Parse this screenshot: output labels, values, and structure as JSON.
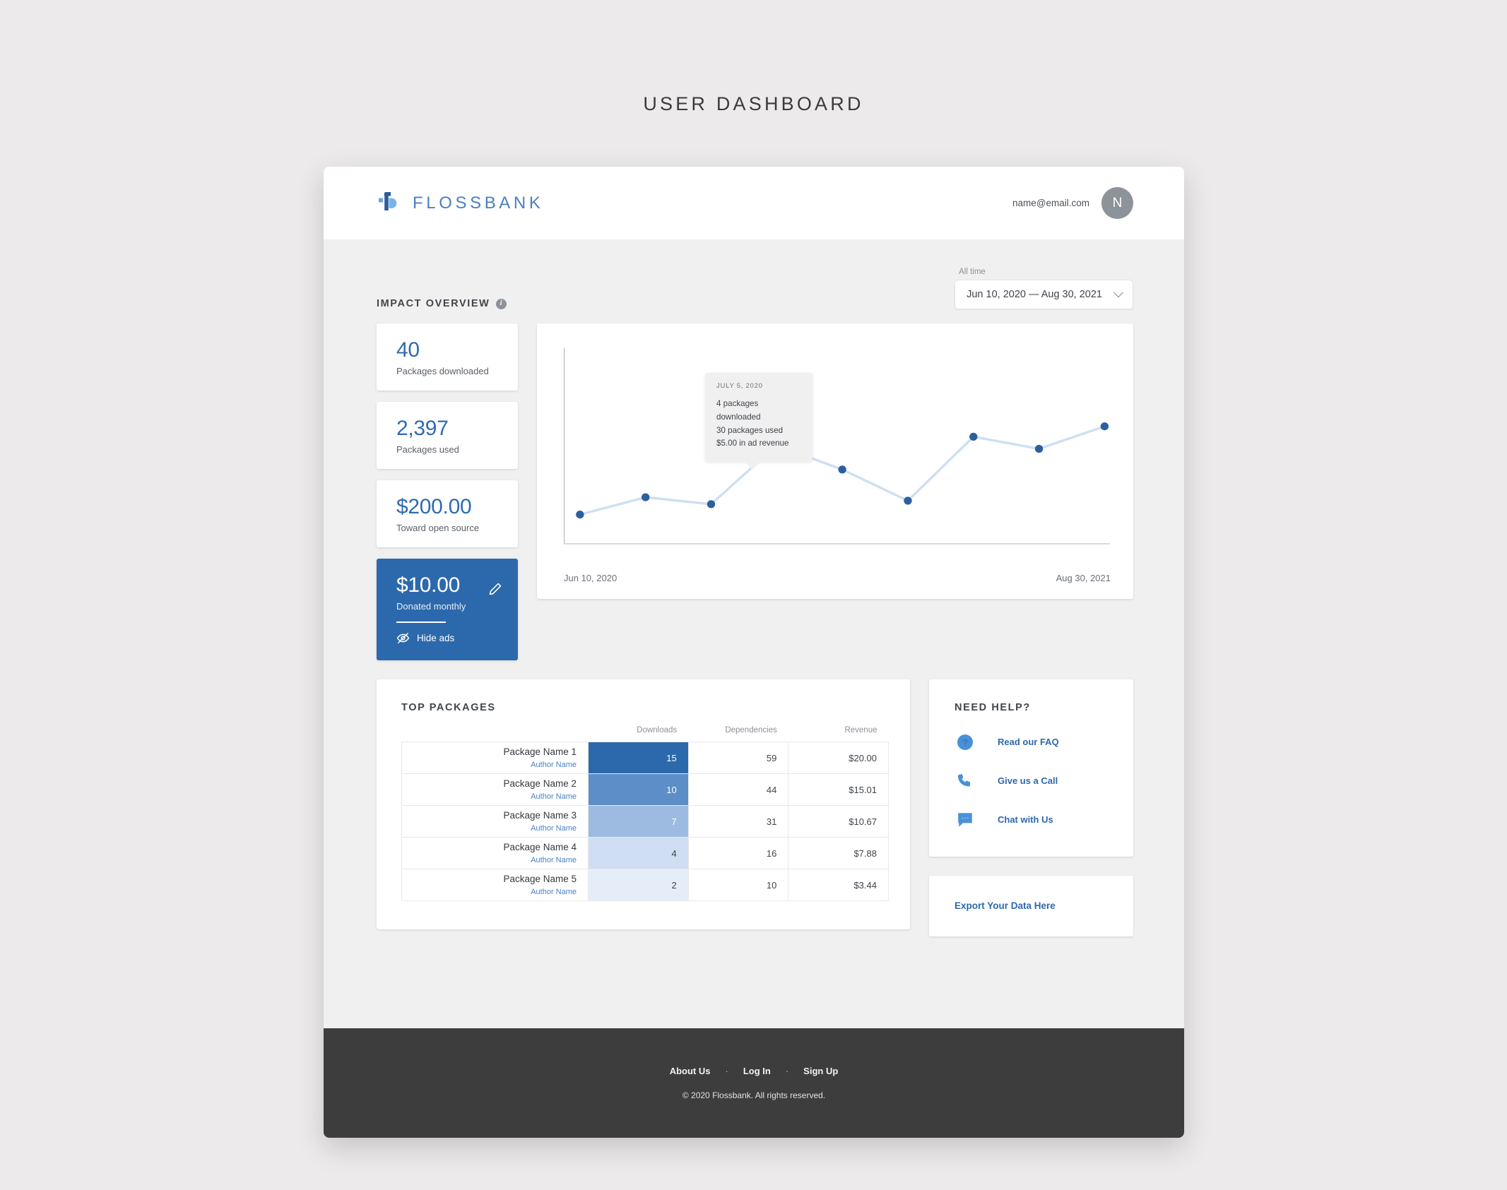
{
  "page": {
    "title": "USER DASHBOARD"
  },
  "header": {
    "brand": "FLOSSBANK",
    "brand_icon": "flossbank-logo-icon",
    "user_email": "name@email.com",
    "avatar_initial": "N"
  },
  "overview": {
    "section_title": "IMPACT OVERVIEW",
    "info_icon": "info-icon",
    "range_label": "All time",
    "range_value": "Jun 10, 2020 — Aug 30, 2021",
    "chevron_icon": "chevron-down-icon",
    "stats": [
      {
        "value": "40",
        "label": "Packages downloaded"
      },
      {
        "value": "2,397",
        "label": "Packages used"
      },
      {
        "value": "$200.00",
        "label": "Toward open source"
      }
    ],
    "donation": {
      "value": "$10.00",
      "label": "Donated monthly",
      "edit_icon": "pencil-icon",
      "hide_ads_icon": "eye-off-icon",
      "hide_ads_label": "Hide ads"
    }
  },
  "chart_data": {
    "type": "line",
    "title": "",
    "xlabel": "",
    "ylabel": "",
    "x_axis_start_label": "Jun 10, 2020",
    "x_axis_end_label": "Aug 30, 2021",
    "grid": false,
    "legend": "none",
    "x": [
      1,
      2,
      3,
      4,
      5,
      6,
      7,
      8,
      9
    ],
    "values": [
      12,
      22,
      18,
      52,
      38,
      20,
      57,
      50,
      63
    ],
    "ylim": [
      0,
      100
    ],
    "series": [
      {
        "name": "Packages downloaded",
        "values": [
          12,
          22,
          18,
          52,
          38,
          20,
          57,
          50,
          63
        ],
        "line_color": "#cddff3",
        "point_color": "#2c5f9e"
      }
    ],
    "annotations": [
      {
        "attached_to_index": 4,
        "date": "JULY 5, 2020",
        "lines": [
          "4 packages downloaded",
          "30 packages used",
          "$5.00 in ad revenue"
        ]
      }
    ]
  },
  "packages": {
    "title": "TOP PACKAGES",
    "columns": [
      "",
      "Downloads",
      "Dependencies",
      "Revenue"
    ],
    "rows": [
      {
        "name": "Package Name 1",
        "author": "Author Name",
        "downloads": "15",
        "dependencies": "59",
        "revenue": "$20.00",
        "bar_color": "#2c69ac",
        "text_color": "#ffffff"
      },
      {
        "name": "Package Name 2",
        "author": "Author Name",
        "downloads": "10",
        "dependencies": "44",
        "revenue": "$15.01",
        "bar_color": "#5d8ec7",
        "text_color": "#ffffff"
      },
      {
        "name": "Package Name 3",
        "author": "Author Name",
        "downloads": "7",
        "dependencies": "31",
        "revenue": "$10.67",
        "bar_color": "#9dbbe0",
        "text_color": "#ffffff"
      },
      {
        "name": "Package Name 4",
        "author": "Author Name",
        "downloads": "4",
        "dependencies": "16",
        "revenue": "$7.88",
        "bar_color": "#cfdef2",
        "text_color": "#3f4349"
      },
      {
        "name": "Package Name 5",
        "author": "Author Name",
        "downloads": "2",
        "dependencies": "10",
        "revenue": "$3.44",
        "bar_color": "#e5edf9",
        "text_color": "#3f4349"
      }
    ]
  },
  "help": {
    "title": "NEED HELP?",
    "items": [
      {
        "label": "Read our FAQ",
        "icon": "question-circle-icon"
      },
      {
        "label": "Give us a Call",
        "icon": "phone-icon"
      },
      {
        "label": "Chat with Us",
        "icon": "chat-bubble-icon"
      }
    ]
  },
  "export": {
    "label": "Export Your Data Here"
  },
  "footer": {
    "links": [
      "About Us",
      "Log In",
      "Sign Up"
    ],
    "separator": "·",
    "copyright": "© 2020 Flossbank. All rights reserved."
  },
  "colors": {
    "accent_blue": "#2c69ac",
    "light_blue": "#4a7fc1",
    "line_blue": "#cddff3",
    "page_bg": "#eceaea",
    "app_bg": "#f1f0f0",
    "footer_bg": "#3d3d3d"
  }
}
